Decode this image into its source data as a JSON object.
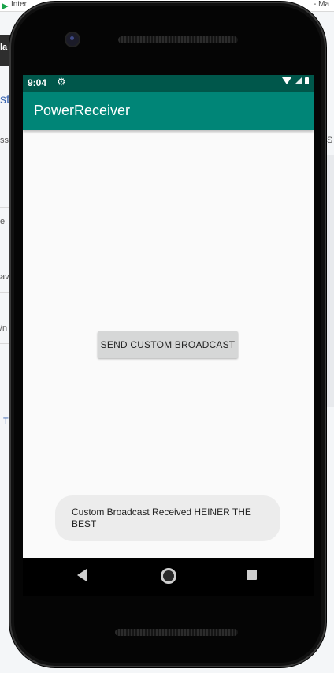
{
  "desktop": {
    "title_left": "Inter",
    "title_right": "- Ma",
    "fragments": [
      "la",
      "st",
      "ssu",
      "e",
      "ava",
      "/n",
      "T",
      "S"
    ]
  },
  "status_bar": {
    "time": "9:04",
    "settings_icon": "gear-icon",
    "icons": [
      "wifi-icon",
      "signal-icon",
      "battery-icon"
    ]
  },
  "app_bar": {
    "title": "PowerReceiver",
    "color": "#008577",
    "status_color": "#00574b"
  },
  "main": {
    "send_button_label": "SEND CUSTOM BROADCAST"
  },
  "toast": {
    "message": "Custom Broadcast Received HEINER THE BEST"
  },
  "nav_bar": {
    "back": "back-icon",
    "home": "home-icon",
    "recents": "recents-icon"
  }
}
